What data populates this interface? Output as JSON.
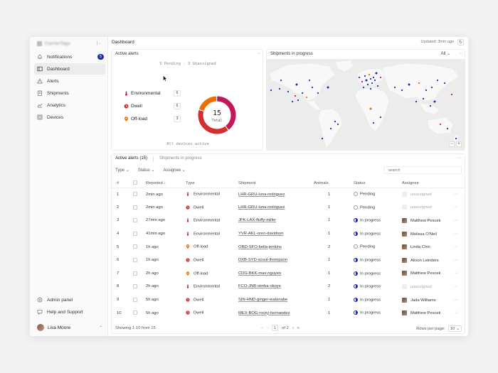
{
  "sidebar": {
    "brand": "CarrierTags",
    "items": [
      {
        "label": "Notifications",
        "icon": "bell-icon",
        "badge": "5"
      },
      {
        "label": "Dashboard",
        "icon": "dashboard-icon",
        "active": true
      },
      {
        "label": "Alerts",
        "icon": "warning-icon"
      },
      {
        "label": "Shipments",
        "icon": "clipboard-icon"
      },
      {
        "label": "Analytics",
        "icon": "chart-icon"
      },
      {
        "label": "Devices",
        "icon": "devices-icon"
      }
    ],
    "bottom": [
      {
        "label": "Admin panel",
        "icon": "admin-icon"
      },
      {
        "label": "Help and Support",
        "icon": "help-icon"
      }
    ],
    "user": "Lisa Moore"
  },
  "header": {
    "title": "Dashboard",
    "updated": "Updated: 3min ago"
  },
  "alerts_card": {
    "title": "Active alerts",
    "summary": "5 Pending · 3 Unassigned",
    "rows": [
      {
        "label": "Environmental",
        "count": "6",
        "color": "#c2185b"
      },
      {
        "label": "Dwell",
        "count": "6",
        "color": "#d32f2f"
      },
      {
        "label": "Off-load",
        "count": "3",
        "color": "#ef6c00"
      }
    ],
    "total": "15",
    "total_label": "Total",
    "footer": "All devices active",
    "donut": [
      6,
      6,
      3
    ]
  },
  "map_card": {
    "title": "Shipments in progress",
    "filter": "All"
  },
  "table_card": {
    "tabs": [
      "Active alerts (15)",
      "Shipments in progress"
    ],
    "filters": [
      "Type",
      "Status",
      "Assignee"
    ],
    "search_placeholder": "search",
    "columns": [
      "#",
      "",
      "Reported",
      "Type",
      "Shipment",
      "Animals",
      "Status",
      "Assignee"
    ],
    "rows": [
      {
        "n": "1",
        "reported": "2min ago",
        "type": "Environmental",
        "tcolor": "#c2185b",
        "shipment": "LHR-GRU-luna-rodriguez",
        "animals": "1",
        "status": "Pending",
        "assignee": "unassigned"
      },
      {
        "n": "2",
        "reported": "2min ago",
        "type": "Dwell",
        "tcolor": "#d32f2f",
        "shipment": "LHR-GRU-luna-rodriguez",
        "animals": "1",
        "status": "Pending",
        "assignee": "unassigned"
      },
      {
        "n": "3",
        "reported": "27min ago",
        "type": "Environmental",
        "tcolor": "#c2185b",
        "shipment": "JFK-LAX-fluffy-miller",
        "animals": "1",
        "status": "In progress",
        "assignee": "Matthew Pescek"
      },
      {
        "n": "4",
        "reported": "41min ago",
        "type": "Environmental",
        "tcolor": "#c2185b",
        "shipment": "YVR-AKL-oreo-davidson",
        "animals": "1",
        "status": "In progress",
        "assignee": "Melissa O'Neil"
      },
      {
        "n": "5",
        "reported": "1h ago",
        "type": "Off-load",
        "tcolor": "#ef6c00",
        "shipment": "ORD-SFO-bella-jenkins",
        "animals": "2",
        "status": "Pending",
        "assignee": "Linda Chin"
      },
      {
        "n": "6",
        "reported": "1h ago",
        "type": "Dwell",
        "tcolor": "#d32f2f",
        "shipment": "DXB-SYD-scout-thompson",
        "animals": "1",
        "status": "In progress",
        "assignee": "Alison Leinders"
      },
      {
        "n": "7",
        "reported": "2h ago",
        "type": "Off-load",
        "tcolor": "#ef6c00",
        "shipment": "CDG-BKK-max-nguyen",
        "animals": "1",
        "status": "In progress",
        "assignee": "Matthew Pescek"
      },
      {
        "n": "8",
        "reported": "2h ago",
        "type": "Environmental",
        "tcolor": "#c2185b",
        "shipment": "FCO-JNB-simba-okoye",
        "animals": "2",
        "status": "In progress",
        "assignee": "unassigned"
      },
      {
        "n": "9",
        "reported": "5h ago",
        "type": "Dwell",
        "tcolor": "#d32f2f",
        "shipment": "SIN-HND-ginger-watanabe",
        "animals": "1",
        "status": "In progress",
        "assignee": "Jada Williams"
      },
      {
        "n": "10",
        "reported": "5h ago",
        "type": "Dwell",
        "tcolor": "#d32f2f",
        "shipment": "MEX-BOG-rocky-hernandez",
        "animals": "1",
        "status": "In progress",
        "assignee": "Matthew Pescek"
      }
    ],
    "showing": "Showing 1-10 from 15",
    "page": "1",
    "of_pages": "of 2",
    "rows_per_page_label": "Rows per page:",
    "rows_per_page": "10"
  }
}
